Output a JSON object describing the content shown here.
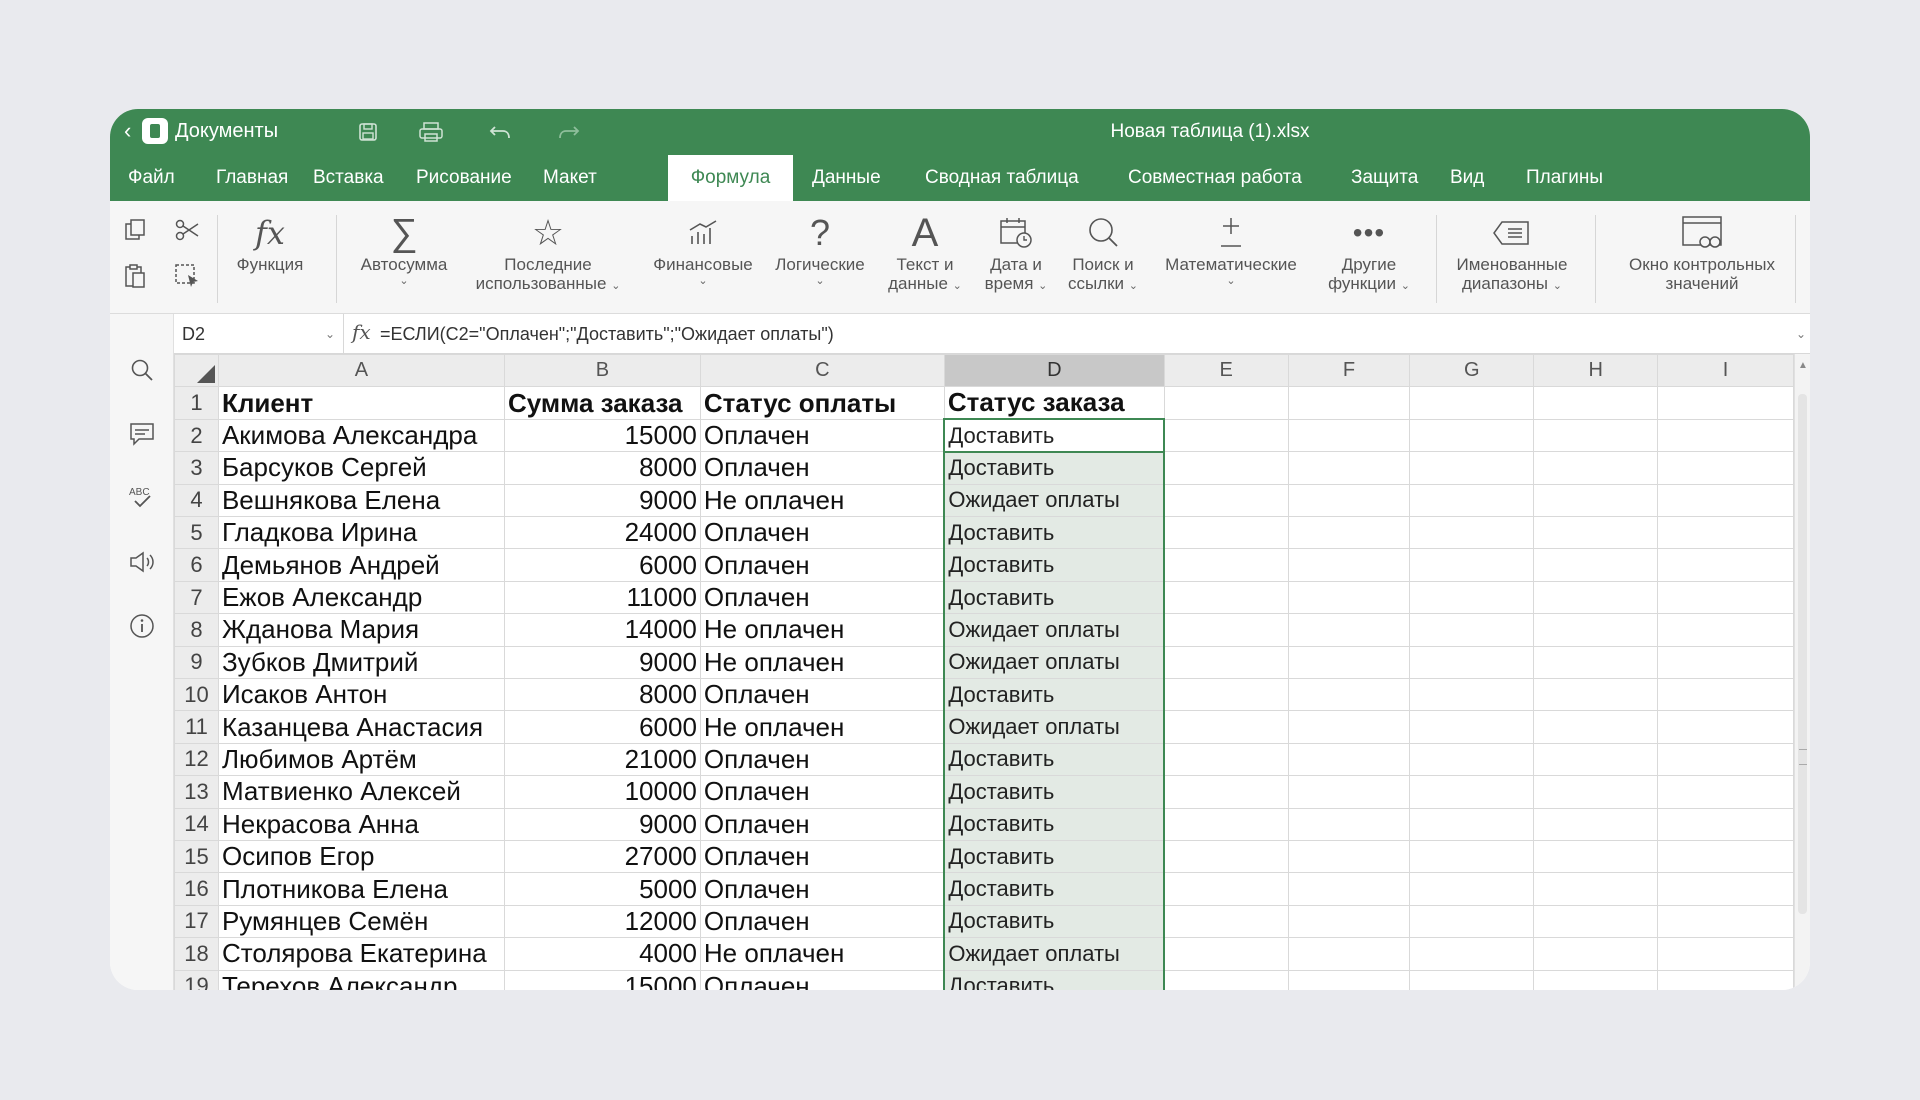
{
  "titlebar": {
    "back_icon": "chevron-left-icon",
    "app_label": "Документы",
    "doc_title": "Новая таблица (1).xlsx",
    "icons": [
      "save-icon",
      "print-icon",
      "undo-icon",
      "redo-icon"
    ]
  },
  "menu": {
    "tabs": [
      "Файл",
      "Главная",
      "Вставка",
      "Рисование",
      "Макет",
      "Формула",
      "Данные",
      "Сводная таблица",
      "Совместная работа",
      "Защита",
      "Вид",
      "Плагины"
    ],
    "active": "Формула"
  },
  "ribbon": {
    "function": "Функция",
    "autosum": "Автосумма",
    "recent_1": "Последние",
    "recent_2": "использованные",
    "financial": "Финансовые",
    "logical": "Логические",
    "text_1": "Текст и",
    "text_2": "данные",
    "date_1": "Дата и",
    "date_2": "время",
    "lookup_1": "Поиск и",
    "lookup_2": "ссылки",
    "math": "Математические",
    "other_1": "Другие",
    "other_2": "функции",
    "named_1": "Именованные",
    "named_2": "диапазоны",
    "watch_1": "Окно контрольных",
    "watch_2": "значений"
  },
  "formula_bar": {
    "cell_ref": "D2",
    "fx": "fx",
    "formula": "=ЕСЛИ(C2=\"Оплачен\";\"Доставить\";\"Ожидает оплаты\")"
  },
  "sheet": {
    "columns": [
      "A",
      "B",
      "C",
      "D",
      "E",
      "F",
      "G",
      "H",
      "I"
    ],
    "selected_column": "D",
    "header_row": [
      "Клиент",
      "Сумма заказа",
      "Статус оплаты",
      "Статус заказа"
    ],
    "rows": [
      [
        "Акимова Александра",
        "15000",
        "Оплачен",
        "Доставить"
      ],
      [
        "Барсуков Сергей",
        "8000",
        "Оплачен",
        "Доставить"
      ],
      [
        "Вешнякова Елена",
        "9000",
        "Не оплачен",
        "Ожидает оплаты"
      ],
      [
        "Гладкова Ирина",
        "24000",
        "Оплачен",
        "Доставить"
      ],
      [
        "Демьянов Андрей",
        "6000",
        "Оплачен",
        "Доставить"
      ],
      [
        "Ежов Александр",
        "11000",
        "Оплачен",
        "Доставить"
      ],
      [
        "Жданова Мария",
        "14000",
        "Не оплачен",
        "Ожидает оплаты"
      ],
      [
        "Зубков Дмитрий",
        "9000",
        "Не оплачен",
        "Ожидает оплаты"
      ],
      [
        "Исаков Антон",
        "8000",
        "Оплачен",
        "Доставить"
      ],
      [
        "Казанцева Анастасия",
        "6000",
        "Не оплачен",
        "Ожидает оплаты"
      ],
      [
        "Любимов Артём",
        "21000",
        "Оплачен",
        "Доставить"
      ],
      [
        "Матвиенко Алексей",
        "10000",
        "Оплачен",
        "Доставить"
      ],
      [
        "Некрасова Анна",
        "9000",
        "Оплачен",
        "Доставить"
      ],
      [
        "Осипов Егор",
        "27000",
        "Оплачен",
        "Доставить"
      ],
      [
        "Плотникова Елена",
        "5000",
        "Оплачен",
        "Доставить"
      ],
      [
        "Румянцев Семён",
        "12000",
        "Оплачен",
        "Доставить"
      ],
      [
        "Столярова Екатерина",
        "4000",
        "Не оплачен",
        "Ожидает оплаты"
      ],
      [
        "Терехов Александр",
        "15000",
        "Оплачен",
        "Доставить"
      ]
    ]
  },
  "colors": {
    "accent": "#3e8853",
    "selection_fill": "#e3eae4"
  }
}
